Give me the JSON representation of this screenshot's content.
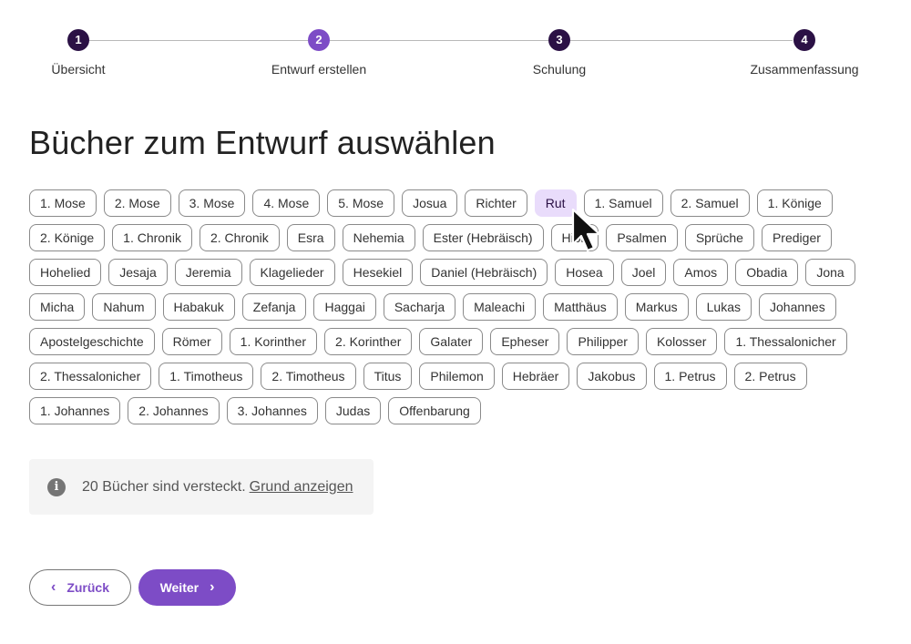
{
  "stepper": {
    "steps": [
      {
        "number": "1",
        "label": "Übersicht",
        "state": "complete"
      },
      {
        "number": "2",
        "label": "Entwurf erstellen",
        "state": "active"
      },
      {
        "number": "3",
        "label": "Schulung",
        "state": "pending"
      },
      {
        "number": "4",
        "label": "Zusammenfassung",
        "state": "pending"
      }
    ]
  },
  "page": {
    "title": "Bücher zum Entwurf auswählen"
  },
  "books": [
    {
      "label": "1. Mose"
    },
    {
      "label": "2. Mose"
    },
    {
      "label": "3. Mose"
    },
    {
      "label": "4. Mose"
    },
    {
      "label": "5. Mose"
    },
    {
      "label": "Josua"
    },
    {
      "label": "Richter"
    },
    {
      "label": "Rut",
      "selected": true
    },
    {
      "label": "1. Samuel"
    },
    {
      "label": "2. Samuel"
    },
    {
      "label": "1. Könige"
    },
    {
      "label": "2. Könige"
    },
    {
      "label": "1. Chronik"
    },
    {
      "label": "2. Chronik"
    },
    {
      "label": "Esra"
    },
    {
      "label": "Nehemia"
    },
    {
      "label": "Ester (Hebräisch)"
    },
    {
      "label": "Hiob"
    },
    {
      "label": "Psalmen"
    },
    {
      "label": "Sprüche"
    },
    {
      "label": "Prediger"
    },
    {
      "label": "Hohelied"
    },
    {
      "label": "Jesaja"
    },
    {
      "label": "Jeremia"
    },
    {
      "label": "Klagelieder"
    },
    {
      "label": "Hesekiel"
    },
    {
      "label": "Daniel (Hebräisch)"
    },
    {
      "label": "Hosea"
    },
    {
      "label": "Joel"
    },
    {
      "label": "Amos"
    },
    {
      "label": "Obadia"
    },
    {
      "label": "Jona"
    },
    {
      "label": "Micha"
    },
    {
      "label": "Nahum"
    },
    {
      "label": "Habakuk"
    },
    {
      "label": "Zefanja"
    },
    {
      "label": "Haggai"
    },
    {
      "label": "Sacharja"
    },
    {
      "label": "Maleachi"
    },
    {
      "label": "Matthäus"
    },
    {
      "label": "Markus"
    },
    {
      "label": "Lukas"
    },
    {
      "label": "Johannes"
    },
    {
      "label": "Apostelgeschichte"
    },
    {
      "label": "Römer"
    },
    {
      "label": "1. Korinther"
    },
    {
      "label": "2. Korinther"
    },
    {
      "label": "Galater"
    },
    {
      "label": "Epheser"
    },
    {
      "label": "Philipper"
    },
    {
      "label": "Kolosser"
    },
    {
      "label": "1. Thessalonicher"
    },
    {
      "label": "2. Thessalonicher"
    },
    {
      "label": "1. Timotheus"
    },
    {
      "label": "2. Timotheus"
    },
    {
      "label": "Titus"
    },
    {
      "label": "Philemon"
    },
    {
      "label": "Hebräer"
    },
    {
      "label": "Jakobus"
    },
    {
      "label": "1. Petrus"
    },
    {
      "label": "2. Petrus"
    },
    {
      "label": "1. Johannes"
    },
    {
      "label": "2. Johannes"
    },
    {
      "label": "3. Johannes"
    },
    {
      "label": "Judas"
    },
    {
      "label": "Offenbarung"
    }
  ],
  "notice": {
    "icon": "info-icon",
    "text": "20 Bücher sind versteckt.",
    "link": "Grund anzeigen"
  },
  "buttons": {
    "back_label": "Zurück",
    "next_label": "Weiter"
  },
  "colors": {
    "accent": "#7d4cc6",
    "step_dark": "#2b1145",
    "selected_chip_bg": "#e9dcfb"
  }
}
